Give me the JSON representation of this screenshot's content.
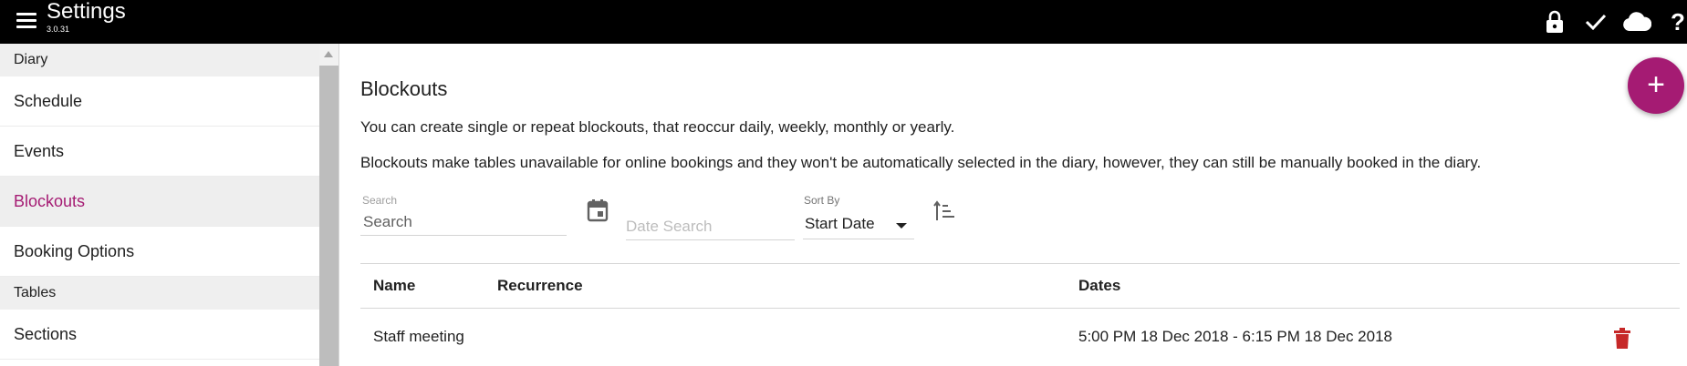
{
  "topbar": {
    "title": "Settings",
    "version": "3.0.31",
    "icons": [
      "menu-icon",
      "lock-icon",
      "check-icon",
      "cloud-icon",
      "help-icon"
    ],
    "help_glyph": "?",
    "background": "#000000"
  },
  "sidebar": {
    "sections": [
      {
        "header": "Diary",
        "items": [
          "Schedule",
          "Events",
          "Blockouts",
          "Booking Options"
        ]
      },
      {
        "header": "Tables",
        "items": [
          "Sections"
        ]
      }
    ],
    "active_item": "Blockouts",
    "accent": "#a51b73"
  },
  "main": {
    "title": "Blockouts",
    "description1": "You can create single or repeat blockouts, that reoccur daily, weekly, monthly or yearly.",
    "description2": "Blockouts make tables unavailable for online bookings and they won't be automatically selected in the diary, however, they can still be manually booked in the diary.",
    "add_button": "+",
    "filters": {
      "search_label": "Search",
      "search_placeholder": "Search",
      "search_value": "",
      "date_placeholder": "Date Search",
      "sort_label": "Sort By",
      "sort_value": "Start Date"
    },
    "table": {
      "columns": [
        "Name",
        "Recurrence",
        "Dates"
      ],
      "rows": [
        {
          "name": "Staff meeting",
          "recurrence": "",
          "dates": "5:00 PM 18 Dec 2018 - 6:15 PM 18 Dec 2018"
        }
      ]
    },
    "delete_color": "#c62828"
  }
}
